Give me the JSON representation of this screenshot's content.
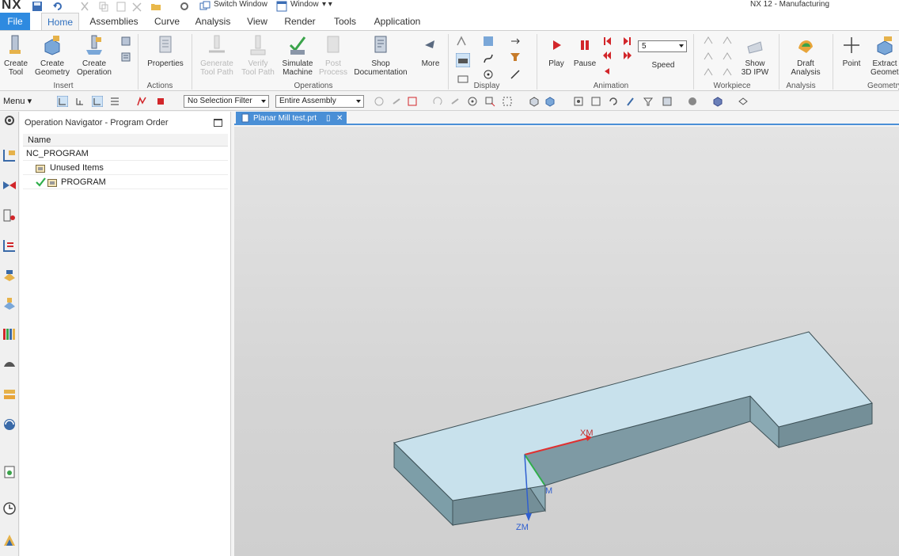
{
  "app": {
    "logo": "NX",
    "title": "NX 12 - Manufacturing",
    "switch_window": "Switch Window",
    "window_menu": "Window",
    "window_menu_arrow": "▾ ▾"
  },
  "tabs": [
    "File",
    "Home",
    "Assemblies",
    "Curve",
    "Analysis",
    "View",
    "Render",
    "Tools",
    "Application"
  ],
  "ribbon": {
    "insert": {
      "label": "Insert",
      "create_tool": [
        "Create",
        "Tool"
      ],
      "create_geometry": [
        "Create",
        "Geometry"
      ],
      "create_operation": [
        "Create",
        "Operation"
      ]
    },
    "actions": {
      "label": "Actions",
      "properties": "Properties"
    },
    "operations": {
      "label": "Operations",
      "generate": [
        "Generate",
        "Tool Path"
      ],
      "verify": [
        "Verify",
        "Tool Path"
      ],
      "simulate": [
        "Simulate",
        "Machine"
      ],
      "post": [
        "Post",
        "Process"
      ],
      "shop": [
        "Shop",
        "Documentation"
      ],
      "more": "More"
    },
    "display": {
      "label": "Display"
    },
    "animation": {
      "label": "Animation",
      "play": "Play",
      "pause": "Pause",
      "speed_value": "5",
      "speed_label": "Speed"
    },
    "workpiece": {
      "label": "Workpiece",
      "show_ipw": [
        "Show",
        "3D IPW"
      ]
    },
    "analysis": {
      "label": "Analysis",
      "draft": [
        "Draft",
        "Analysis"
      ]
    },
    "geometry": {
      "label": "Geometry",
      "point": "Point",
      "extract": [
        "Extract",
        "Geometry"
      ]
    }
  },
  "selection_bar": {
    "menu": "Menu",
    "filter": "No Selection Filter",
    "scope": "Entire Assembly"
  },
  "navigator": {
    "title": "Operation Navigator - Program Order",
    "column": "Name",
    "rows": [
      {
        "label": "NC_PROGRAM"
      },
      {
        "label": "Unused Items"
      },
      {
        "label": "PROGRAM"
      }
    ]
  },
  "graphics": {
    "tab_label": "Planar Mill test.prt",
    "axis_labels": {
      "x": "XM",
      "y": "M",
      "z": "ZM"
    }
  },
  "colors": {
    "file_tab": "#2e8ae0",
    "part_top": "#c8e1ec",
    "part_side": "#7d9ea8",
    "axis_x": "#e03030",
    "axis_y": "#2fae4a",
    "axis_z": "#2f5fd0"
  }
}
